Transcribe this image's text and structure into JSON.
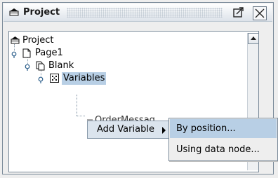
{
  "panel": {
    "title": "Project",
    "icon": "project-icon"
  },
  "tree": {
    "items": [
      {
        "label": "Project",
        "icon": "project-icon"
      },
      {
        "label": "Page1",
        "icon": "page-icon"
      },
      {
        "label": "Blank",
        "icon": "blank-icon"
      },
      {
        "label": "Variables",
        "icon": "variables-icon"
      },
      {
        "label": "OrderMessag",
        "icon": "variable-icon"
      }
    ]
  },
  "context_menu": {
    "add_variable_label": "Add Variable",
    "submenu": [
      {
        "label": "By position..."
      },
      {
        "label": "Using data node..."
      }
    ]
  }
}
